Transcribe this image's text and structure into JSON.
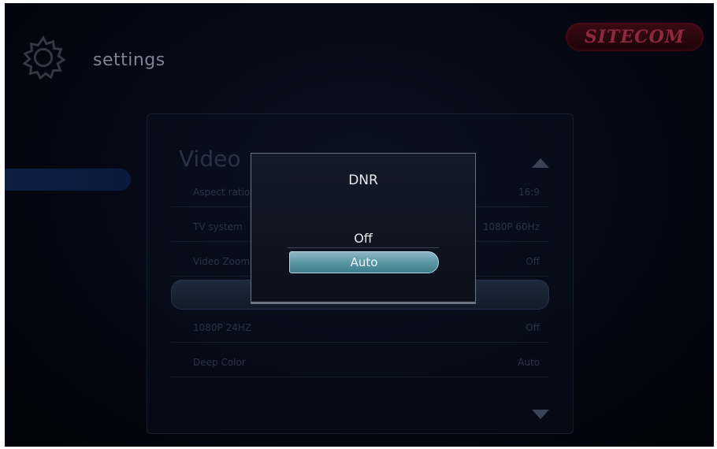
{
  "header": {
    "title": "settings",
    "logo": "SITECOM"
  },
  "panel": {
    "heading": "Video",
    "rows": [
      {
        "label": "Aspect ratio",
        "value": "16:9"
      },
      {
        "label": "TV system",
        "value": "1080P 60Hz"
      },
      {
        "label": "Video Zoom",
        "value": "Off"
      },
      {
        "label": "",
        "value": ""
      },
      {
        "label": "1080P 24HZ",
        "value": "Off"
      },
      {
        "label": "Deep Color",
        "value": "Auto"
      }
    ]
  },
  "dialog": {
    "title": "DNR",
    "options": [
      "Off",
      "Auto"
    ],
    "selected": "Auto"
  }
}
